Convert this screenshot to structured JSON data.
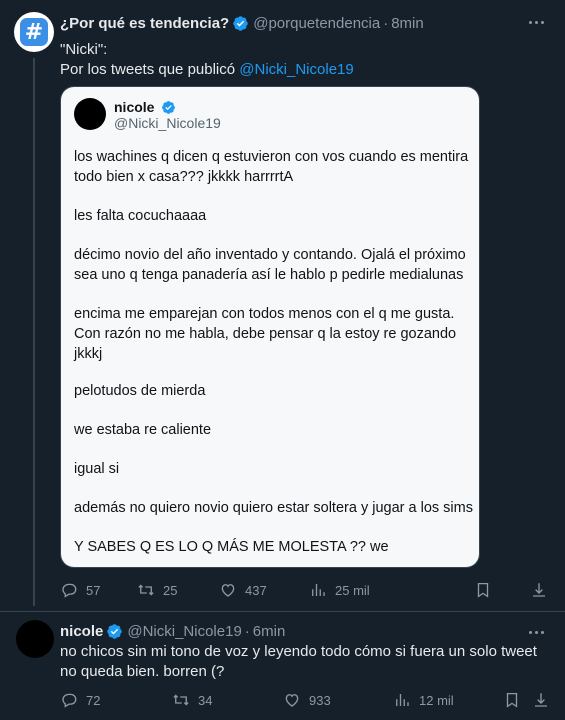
{
  "trend_tweet": {
    "name": "¿Por qué es tendencia?",
    "handle": "@porquetendencia",
    "time": "8min",
    "line1": "\"Nicki\":",
    "line2_prefix": "Por los tweets que publicó ",
    "mention": "@Nicki_Nicole19",
    "quote": {
      "name": "nicole",
      "handle": "@Nicki_Nicole19",
      "paragraphs": [
        "los wachines q dicen q estuvieron con vos cuando es mentira\ntodo bien x casa??? jkkkk harrrrtA",
        "les falta cocuchaaaa",
        "décimo novio del año inventado y contando. Ojalá el próximo\nsea uno q tenga panadería así le hablo p pedirle medialunas",
        "encima me emparejan con todos menos con el q me gusta.\nCon razón no me habla, debe pensar q la estoy re gozando\njkkkj",
        "pelotudos de mierda",
        "we estaba re caliente",
        "igual si",
        "además no quiero novio quiero estar soltera y jugar a los sims",
        "Y SABES Q ES LO Q MÁS ME MOLESTA ?? we"
      ]
    },
    "actions": {
      "replies": "57",
      "retweets": "25",
      "likes": "437",
      "views": "25 mil"
    }
  },
  "reply_tweet": {
    "name": "nicole",
    "handle": "@Nicki_Nicole19",
    "time": "6min",
    "text": "no chicos sin mi tono de voz y leyendo todo cómo si fuera un solo tweet no queda bien. borren (?",
    "actions": {
      "replies": "72",
      "retweets": "34",
      "likes": "933",
      "views": "12 mil"
    }
  },
  "colors": {
    "background": "#15202b",
    "accent": "#1d9bf0",
    "muted": "#8b98a5",
    "divider": "#38444d"
  }
}
